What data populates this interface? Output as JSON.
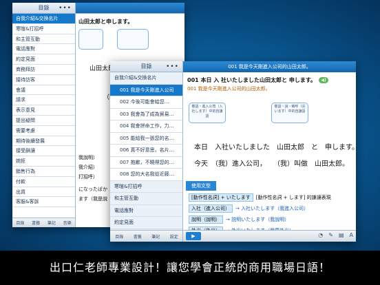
{
  "caption": "出口仁老師專業設計！讓您學會正統的商用職場日語！",
  "back": {
    "sidebar_title": "目錄",
    "dots": "•••",
    "items": [
      "自我介紹&交換名片",
      "寒暄&打招呼",
      "和主管互動",
      "電話應對",
      "約定見面",
      "商務拜訪",
      "接待訪客",
      "會議",
      "請求",
      "表示意見",
      "提出疑問",
      "需要考慮",
      "期待後續發展",
      "接受辭讓",
      "婉拒",
      "銷售行為",
      "付款",
      "出貨",
      "客服&客訴"
    ],
    "title": "山田太郎と申します。",
    "tabbar": [
      "目錄",
      "書籤",
      "筆記",
      "音樂",
      "設定"
    ],
    "lines": [
      "山田太郎",
      "（我",
      "山田太",
      "我說明）",
      "我介紹）",
      "打招呼）",
      "になったばか",
      "ます（我是說",
      "（我是"
    ]
  },
  "front": {
    "sidebar_title": "目錄",
    "dots": "•••",
    "items": [
      {
        "label": "自我介紹&交換名片",
        "cat": true
      },
      {
        "label": "001 我是今天剛進入公司",
        "sel": true,
        "sub": true
      },
      {
        "label": "002 今後可能會給您…",
        "sub": true
      },
      {
        "label": "003 我會為了成為貿易…",
        "sub": true
      },
      {
        "label": "004 我會拼命工作，力…",
        "sub": true
      },
      {
        "label": "005 能給我一張您的名…",
        "sub": true
      },
      {
        "label": "006 真不好意思，名片…",
        "sub": true
      },
      {
        "label": "007 抱歉，不曉得您的…",
        "sub": true
      },
      {
        "label": "008 您的大名我從近藤…",
        "sub": true
      },
      {
        "label": "寒暄&打招呼",
        "cat": true
      },
      {
        "label": "和主管互動",
        "cat": true
      },
      {
        "label": "電話應對",
        "cat": true
      },
      {
        "label": "約定見面",
        "cat": true
      },
      {
        "label": "商務拜訪",
        "cat": true
      }
    ],
    "lesson_header": "001 我是今天剛進入公司的山田太郎。",
    "jp_title": "001 本日 入 社いたしました山田太郎と 申します。",
    "zh_title": "001 我是今天剛進入公司的山田太郎。",
    "bubbles": [
      "敬語・進入公司（入社します）中的自謙語",
      "敬語・說・稱呼（言います）中的自謙語"
    ],
    "jp_line1": "本日　入社いたしました　山田太郎　と　申します。",
    "zh_line1": "今天　（我）進入公司，　　（我）叫做　山田太郎。",
    "usage_header": "使用文型",
    "usage": [
      {
        "left": "[動作性名詞] + いたします",
        "right": "[動作性名詞 + します] 的謙讓表現"
      },
      {
        "left": "入社（進入公司）",
        "right": "→ 入社いたします（我進入公司）"
      },
      {
        "left": "說明（說明）",
        "right": "→ 説明いたします（我說明）"
      },
      {
        "left": "外出（外出）",
        "right": "→ 外出いたします（我要外出）"
      }
    ],
    "play": "▶",
    "tabbar": [
      "目錄",
      "書籤",
      "筆記",
      "設定"
    ]
  }
}
